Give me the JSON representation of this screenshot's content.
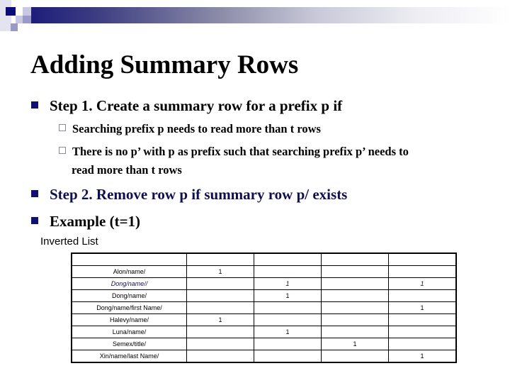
{
  "slide": {
    "title": "Adding Summary Rows",
    "bullets": [
      {
        "text": "Step 1. Create a summary row for a prefix p if",
        "sub": [
          "Searching prefix p needs to read more than t rows",
          "There is no p’ with p as prefix such that searching prefix p’ needs to",
          "read more than t rows"
        ]
      },
      {
        "text": "Step 2. Remove row p if summary row p/ exists"
      },
      {
        "text": "Example (t=1)"
      }
    ],
    "table_label": "Inverted List"
  },
  "colors": {
    "bullet": "#10106e",
    "sub_bullet_border": "#8a8aa4",
    "step2_text": "#0f0f50"
  },
  "table": {
    "header": [
      "",
      "",
      "",
      "",
      ""
    ],
    "rows": [
      {
        "key": "Alon/name/",
        "cells": [
          "1",
          "",
          "",
          ""
        ],
        "highlight": false
      },
      {
        "key": "Dong/name//",
        "cells": [
          "",
          "1",
          "",
          "1"
        ],
        "highlight": true
      },
      {
        "key": "Dong/name/",
        "cells": [
          "",
          "1",
          "",
          ""
        ],
        "highlight": false
      },
      {
        "key": "Dong/name/first Name/",
        "cells": [
          "",
          "",
          "",
          "1"
        ],
        "highlight": false
      },
      {
        "key": "Halevy/name/",
        "cells": [
          "1",
          "",
          "",
          ""
        ],
        "highlight": false
      },
      {
        "key": "Luna/name/",
        "cells": [
          "",
          "1",
          "",
          ""
        ],
        "highlight": false
      },
      {
        "key": "Semex/title/",
        "cells": [
          "",
          "",
          "1",
          ""
        ],
        "highlight": false
      },
      {
        "key": "Xin/name/last Name/",
        "cells": [
          "",
          "",
          "",
          "1"
        ],
        "highlight": false
      }
    ]
  }
}
